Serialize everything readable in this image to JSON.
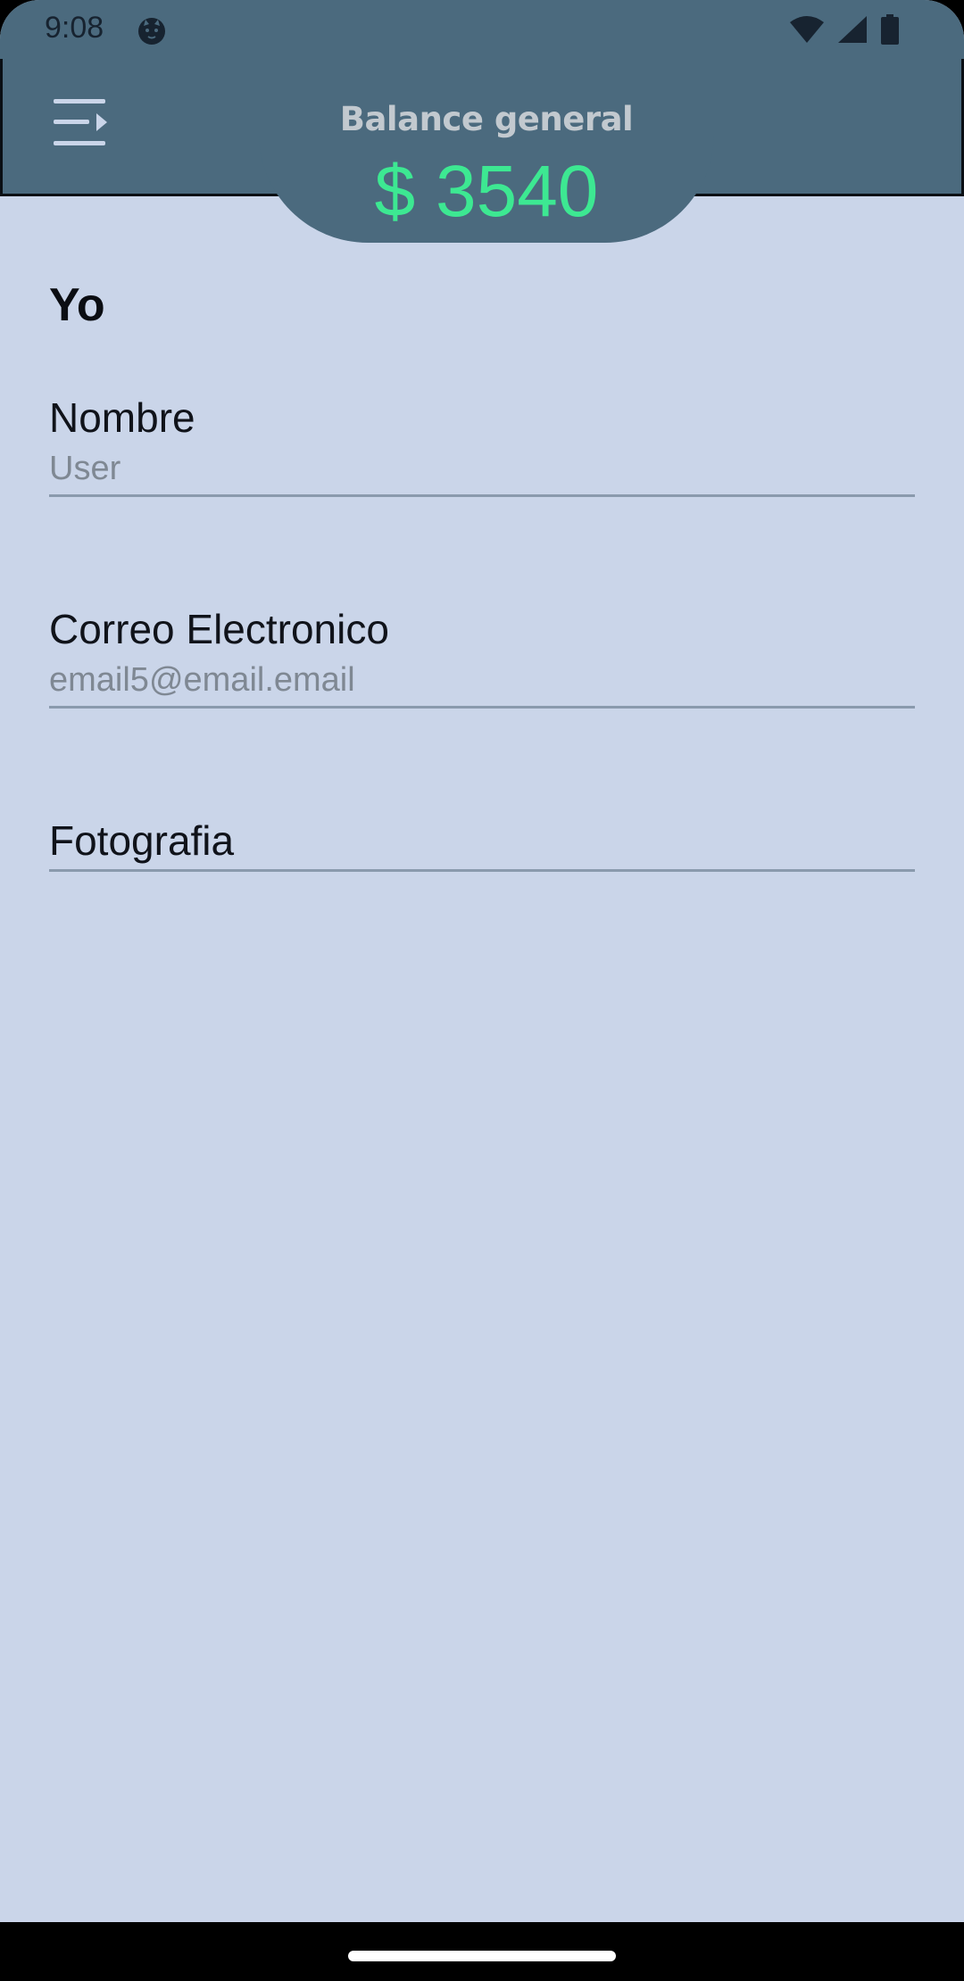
{
  "status_bar": {
    "time": "9:08"
  },
  "header": {
    "balance_label": "Balance general",
    "balance_value": "$ 3540",
    "menu_icon": "menu-open-icon"
  },
  "profile": {
    "section_title": "Yo",
    "fields": [
      {
        "label": "Nombre",
        "value": "User"
      },
      {
        "label": "Correo Electronico",
        "value": "email5@email.email"
      },
      {
        "label": "Fotografia",
        "value": ""
      }
    ]
  },
  "colors": {
    "header_bg": "#4b6a7e",
    "page_bg": "#cad5e9",
    "balance_green": "#3de892"
  }
}
